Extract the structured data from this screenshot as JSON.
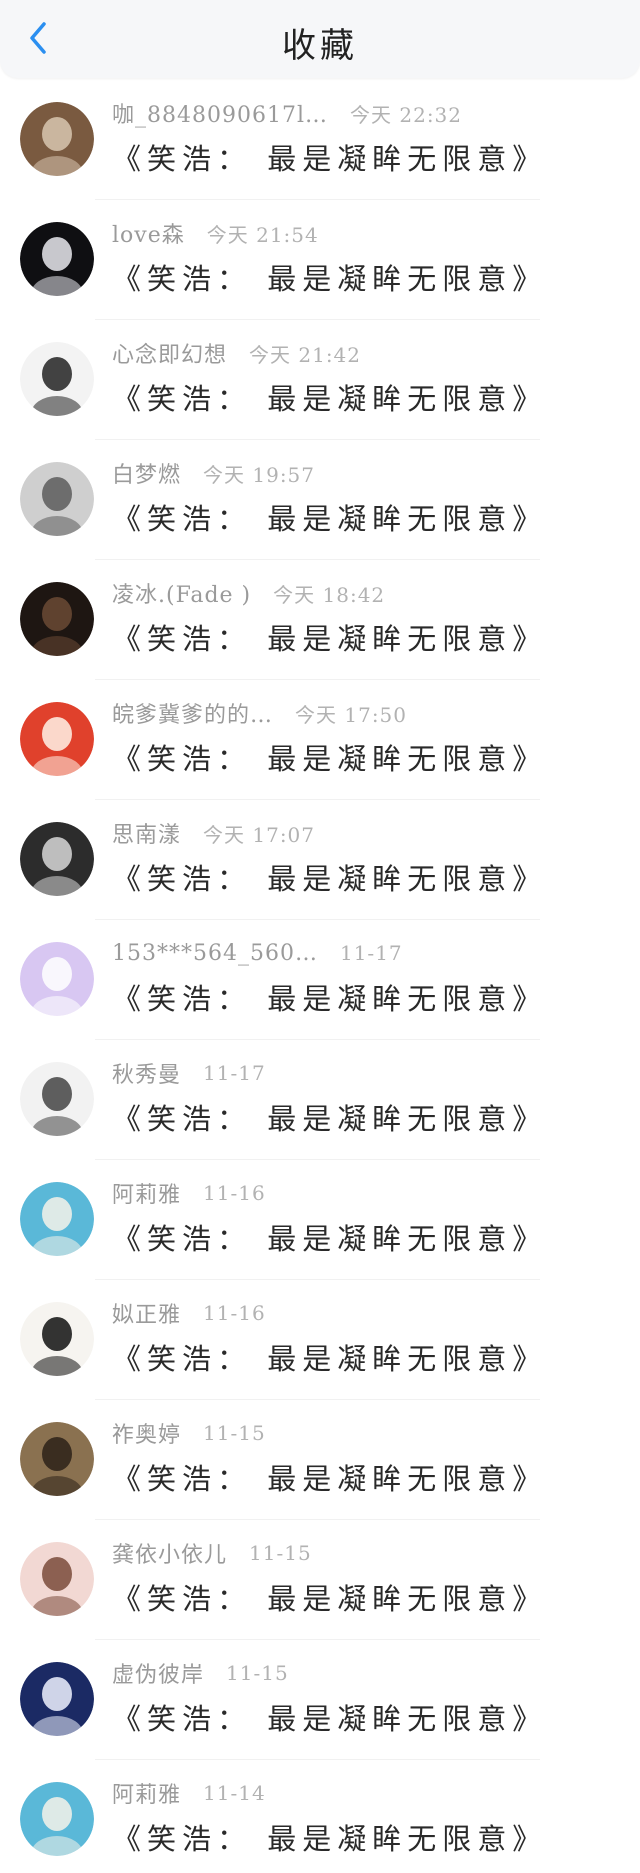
{
  "header": {
    "title": "收藏",
    "back_icon": "chevron-left-icon",
    "accent": "#2b8ff0"
  },
  "items": [
    {
      "name": "咖_8848090617l…",
      "time": "今天 22:32",
      "content": "《笑浩： 最是凝眸无限意》",
      "avatar": {
        "bg": "#7a5a40",
        "fg": "#d8c7b0"
      }
    },
    {
      "name": "love森",
      "time": "今天 21:54",
      "content": "《笑浩： 最是凝眸无限意》",
      "avatar": {
        "bg": "#0f0f12",
        "fg": "#e9e9ee"
      }
    },
    {
      "name": "心念即幻想",
      "time": "今天 21:42",
      "content": "《笑浩： 最是凝眸无限意》",
      "avatar": {
        "bg": "#f3f3f3",
        "fg": "#222222"
      }
    },
    {
      "name": "白梦燃",
      "time": "今天 19:57",
      "content": "《笑浩： 最是凝眸无限意》",
      "avatar": {
        "bg": "#cfcfcf",
        "fg": "#5c5c5c"
      }
    },
    {
      "name": "凌冰.(Fade )",
      "time": "今天 18:42",
      "content": "《笑浩： 最是凝眸无限意》",
      "avatar": {
        "bg": "#1e1612",
        "fg": "#6b4a35"
      }
    },
    {
      "name": "皖爹冀爹的的…",
      "time": "今天 17:50",
      "content": "《笑浩： 最是凝眸无限意》",
      "avatar": {
        "bg": "#e0412c",
        "fg": "#fff3e8"
      }
    },
    {
      "name": "思南漾",
      "time": "今天 17:07",
      "content": "《笑浩： 最是凝眸无限意》",
      "avatar": {
        "bg": "#2c2c2c",
        "fg": "#d8d8d8"
      }
    },
    {
      "name": "153***564_560…",
      "time": "11-17",
      "content": "《笑浩： 最是凝眸无限意》",
      "avatar": {
        "bg": "#d8c7f2",
        "fg": "#ffffff"
      }
    },
    {
      "name": "秋秀曼",
      "time": "11-17",
      "content": "《笑浩： 最是凝眸无限意》",
      "avatar": {
        "bg": "#f2f2f2",
        "fg": "#444444"
      }
    },
    {
      "name": "阿莉雅",
      "time": "11-16",
      "content": "《笑浩： 最是凝眸无限意》",
      "avatar": {
        "bg": "#5ab8d8",
        "fg": "#f6f2ea"
      }
    },
    {
      "name": "姒正雅",
      "time": "11-16",
      "content": "《笑浩： 最是凝眸无限意》",
      "avatar": {
        "bg": "#f6f4f0",
        "fg": "#111111"
      }
    },
    {
      "name": "祚奥婷",
      "time": "11-15",
      "content": "《笑浩： 最是凝眸无限意》",
      "avatar": {
        "bg": "#8a7150",
        "fg": "#2c2118"
      }
    },
    {
      "name": "龚依小依儿",
      "time": "11-15",
      "content": "《笑浩： 最是凝眸无限意》",
      "avatar": {
        "bg": "#f2d8d3",
        "fg": "#7a4b3a"
      }
    },
    {
      "name": "虚伪彼岸",
      "time": "11-15",
      "content": "《笑浩： 最是凝眸无限意》",
      "avatar": {
        "bg": "#1b2a64",
        "fg": "#eef2ff"
      }
    },
    {
      "name": "阿莉雅",
      "time": "11-14",
      "content": "《笑浩： 最是凝眸无限意》",
      "avatar": {
        "bg": "#5ab8d8",
        "fg": "#f6f2ea"
      }
    }
  ]
}
